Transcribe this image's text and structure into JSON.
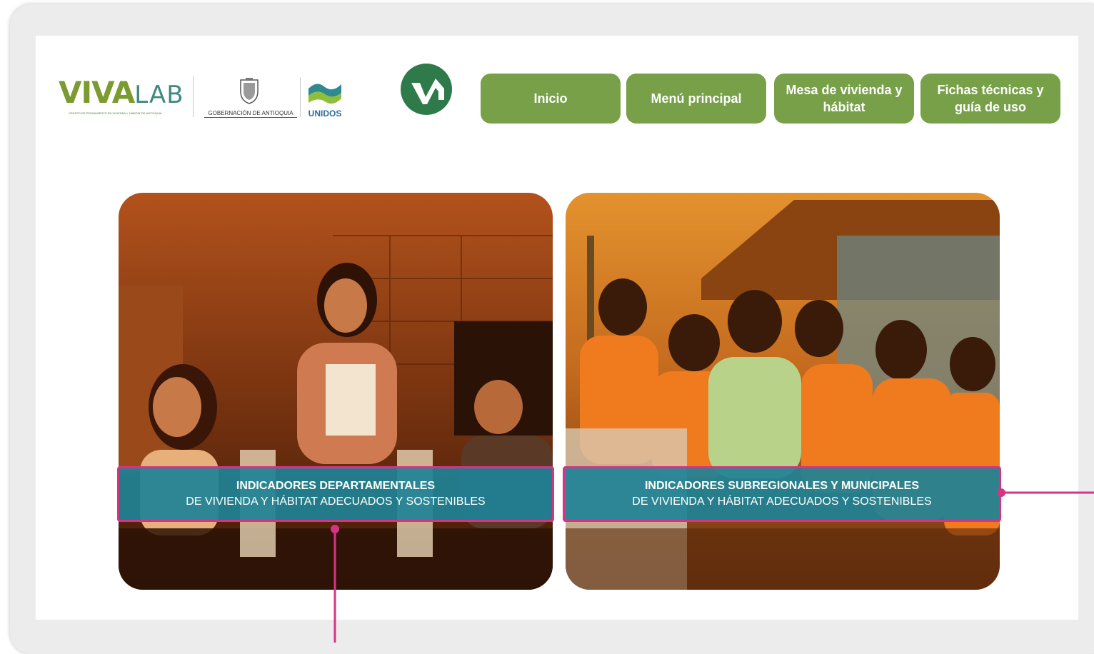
{
  "logos": {
    "viva_word": "VIVA",
    "viva_lab": "LAB",
    "viva_tagline": "CENTRO DE PENSAMIENTO EN VIVIENDA Y HÁBITAT DE ANTIOQUIA",
    "gobernacion": "GOBERNACIÓN DE ANTIOQUIA",
    "unidos": "UNIDOS"
  },
  "nav": {
    "items": [
      {
        "label": "Inicio"
      },
      {
        "label": "Menú principal"
      },
      {
        "label": "Mesa de vivienda y hábitat"
      },
      {
        "label": "Fichas técnicas y guía de uso"
      }
    ]
  },
  "cards": [
    {
      "title": "INDICADORES DEPARTAMENTALES",
      "subtitle": "DE VIVIENDA Y HÁBITAT ADECUADOS Y SOSTENIBLES"
    },
    {
      "title": "INDICADORES SUBREGIONALES Y MUNICIPALES",
      "subtitle": "DE VIVIENDA Y HÁBITAT ADECUADOS Y SOSTENIBLES"
    }
  ],
  "colors": {
    "nav_green": "#78a048",
    "banner_teal": "#1e8296",
    "highlight_pink": "#d63384",
    "logo_green": "#2f7a4a"
  }
}
